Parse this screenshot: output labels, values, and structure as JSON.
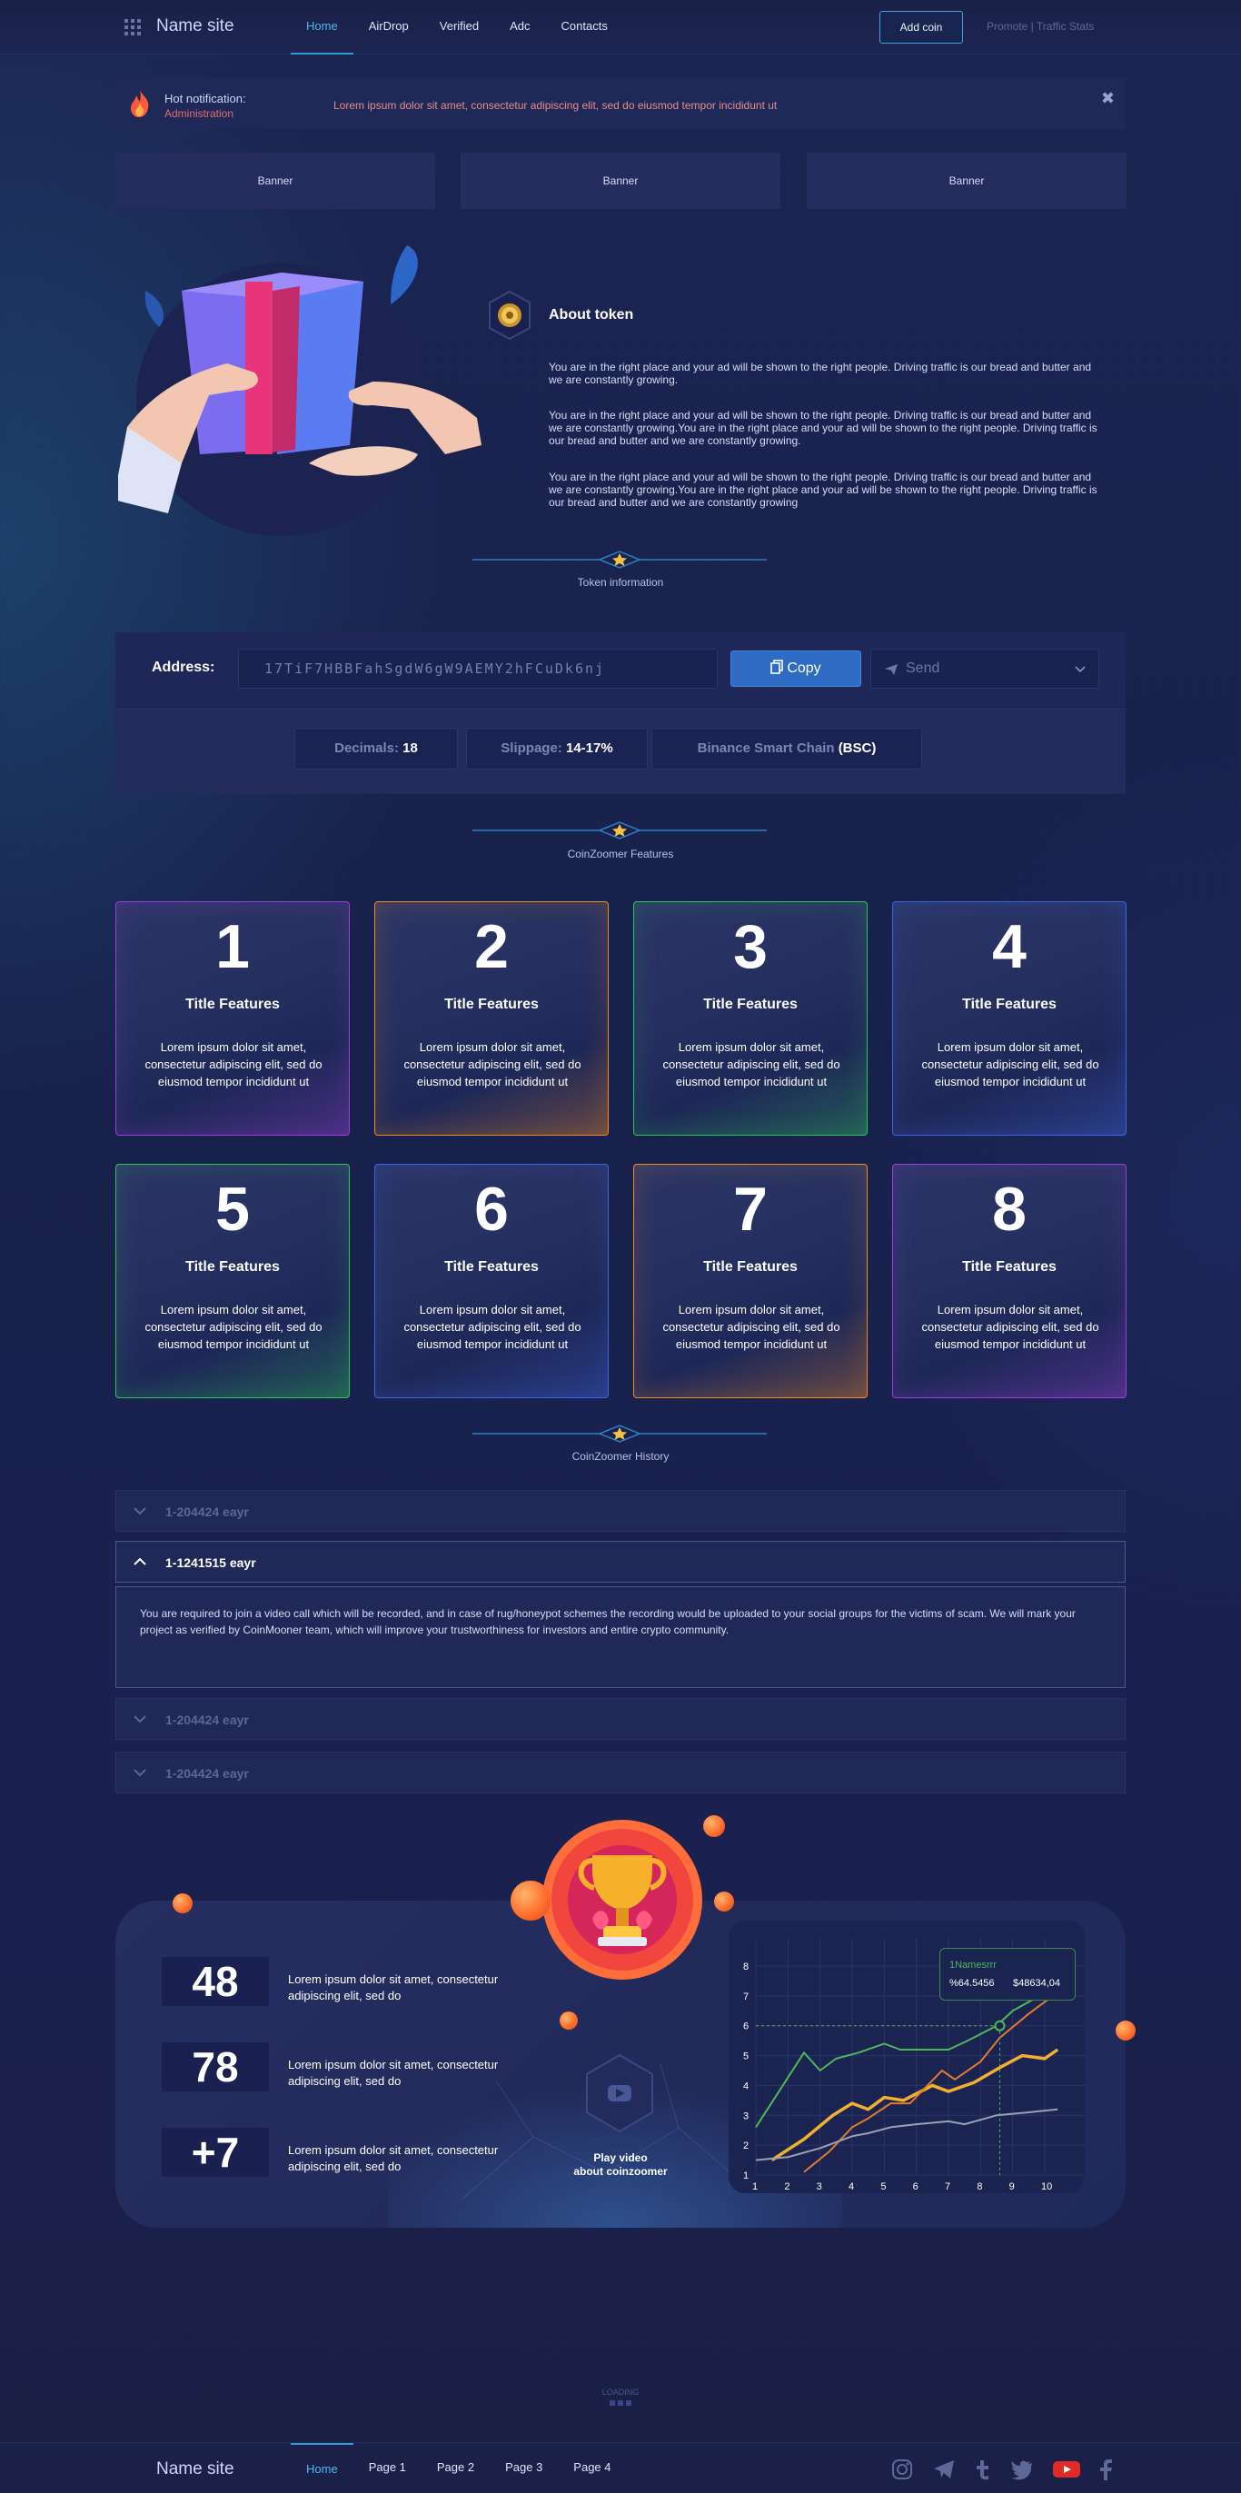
{
  "header": {
    "site_name": "Name site",
    "nav": [
      "Home",
      "AirDrop",
      "Verified",
      "Adc",
      "Contacts"
    ],
    "add_coin": "Add coin",
    "right_links": "Promote | Traffic Stats"
  },
  "notification": {
    "title": "Hot notification:",
    "subtitle": "Administration",
    "text": "Lorem ipsum dolor sit amet, consectetur adipiscing elit, sed do eiusmod tempor incididunt ut"
  },
  "banners": [
    "Banner",
    "Banner",
    "Banner"
  ],
  "about": {
    "title": "About token",
    "paragraphs": [
      "You are in the right place and your ad will be shown to the right people. Driving traffic is our bread and butter and we are constantly growing.",
      "You are in the right place and your ad will be shown to the right people. Driving traffic is our bread and butter and we are constantly growing.You are in the right place and your ad will be shown to the right people. Driving traffic is our bread and butter and we are constantly growing.",
      "You are in the right place and your ad will be shown to the right people. Driving traffic is our bread and butter and we are constantly growing.You are in the right place and your ad will be shown to the right people. Driving traffic is our bread and butter and we are constantly growing"
    ]
  },
  "token_info": {
    "section_label": "Token information",
    "address_label": "Address:",
    "address_value": "17TiF7HBBFahSgdW6gW9AEMY2hFCuDk6nj",
    "copy_label": "Copy",
    "send_label": "Send",
    "decimals_label": "Decimals:",
    "decimals_value": "18",
    "slippage_label": "Slippage:",
    "slippage_value": "14-17%",
    "chain_label": "Binance Smart Chain",
    "chain_value": "(BSC)"
  },
  "features": {
    "section_label": "CoinZoomer Features",
    "items": [
      {
        "num": "1",
        "title": "Title Features",
        "text": "Lorem ipsum dolor sit amet, consectetur adipiscing elit, sed do eiusmod tempor incididunt ut",
        "color": "#9b3fd6"
      },
      {
        "num": "2",
        "title": "Title Features",
        "text": "Lorem ipsum dolor sit amet, consectetur adipiscing elit, sed do eiusmod tempor incididunt ut",
        "color": "#f08a24"
      },
      {
        "num": "3",
        "title": "Title Features",
        "text": "Lorem ipsum dolor sit amet, consectetur adipiscing elit, sed do eiusmod tempor incididunt ut",
        "color": "#2fc45a"
      },
      {
        "num": "4",
        "title": "Title Features",
        "text": "Lorem ipsum dolor sit amet, consectetur adipiscing elit, sed do eiusmod tempor incididunt ut",
        "color": "#3f64e0"
      },
      {
        "num": "5",
        "title": "Title Features",
        "text": "Lorem ipsum dolor sit amet, consectetur adipiscing elit, sed do eiusmod tempor incididunt ut",
        "color": "#2fc45a"
      },
      {
        "num": "6",
        "title": "Title Features",
        "text": "Lorem ipsum dolor sit amet, consectetur adipiscing elit, sed do eiusmod tempor incididunt ut",
        "color": "#3f64e0"
      },
      {
        "num": "7",
        "title": "Title Features",
        "text": "Lorem ipsum dolor sit amet, consectetur adipiscing elit, sed do eiusmod tempor incididunt ut",
        "color": "#f08a24"
      },
      {
        "num": "8",
        "title": "Title Features",
        "text": "Lorem ipsum dolor sit amet, consectetur adipiscing elit, sed do eiusmod tempor incididunt ut",
        "color": "#9b3fd6"
      }
    ]
  },
  "history": {
    "section_label": "CoinZoomer History",
    "items": [
      {
        "label": "1-204424 eayr"
      },
      {
        "label": "1-1241515 eayr",
        "body": "You are required to join a video call which will be recorded, and in case of rug/honeypot schemes the recording would be uploaded to your social groups for the victims of scam. We will mark your project as verified by CoinMooner team, which will improve your trustworthiness for investors and entire crypto community."
      },
      {
        "label": "1-204424 eayr"
      },
      {
        "label": "1-204424 eayr"
      }
    ]
  },
  "stats": {
    "items": [
      {
        "value": "48",
        "text": "Lorem ipsum dolor sit amet, consectetur adipiscing elit, sed do"
      },
      {
        "value": "78",
        "text": "Lorem ipsum dolor sit amet, consectetur adipiscing elit, sed do"
      },
      {
        "value": "+7",
        "text": "Lorem ipsum dolor sit amet, consectetur adipiscing elit, sed do"
      }
    ],
    "play_label_1": "Play video",
    "play_label_2": "about coinzoomer"
  },
  "chart_data": {
    "type": "line",
    "x": [
      1,
      2,
      3,
      4,
      5,
      6,
      7,
      8,
      9,
      10
    ],
    "ylim": [
      1,
      8
    ],
    "xlim": [
      1,
      10
    ],
    "grid": true,
    "series": [
      {
        "color": "#4fb85a",
        "points": [
          [
            1,
            2.6
          ],
          [
            1.6,
            3.6
          ],
          [
            2.5,
            5.1
          ],
          [
            3,
            4.5
          ],
          [
            3.5,
            4.9
          ],
          [
            4.2,
            5.1
          ],
          [
            5,
            5.4
          ],
          [
            5.5,
            5.2
          ],
          [
            7,
            5.2
          ],
          [
            7.6,
            5.5
          ],
          [
            8.5,
            6.0
          ],
          [
            9,
            6.5
          ],
          [
            10,
            7.1
          ],
          [
            10.4,
            7.2
          ]
        ]
      },
      {
        "color": "#f2b030",
        "points": [
          [
            1.5,
            1.5
          ],
          [
            2.5,
            2.2
          ],
          [
            3.4,
            3.0
          ],
          [
            4,
            3.4
          ],
          [
            4.5,
            3.2
          ],
          [
            5,
            3.6
          ],
          [
            5.6,
            3.5
          ],
          [
            6.5,
            4.0
          ],
          [
            7,
            3.8
          ],
          [
            7.8,
            4.1
          ],
          [
            8.6,
            4.6
          ],
          [
            9.3,
            5.0
          ],
          [
            10,
            4.9
          ],
          [
            10.4,
            5.2
          ]
        ]
      },
      {
        "color": "#e07c30",
        "points": [
          [
            2.5,
            1.1
          ],
          [
            3.3,
            1.8
          ],
          [
            4,
            2.6
          ],
          [
            4.5,
            2.9
          ],
          [
            5.2,
            3.4
          ],
          [
            5.8,
            3.4
          ],
          [
            6.8,
            4.5
          ],
          [
            7.2,
            4.2
          ],
          [
            8,
            4.8
          ],
          [
            8.6,
            5.6
          ],
          [
            9.5,
            6.4
          ],
          [
            10,
            6.8
          ],
          [
            10.5,
            7.2
          ]
        ]
      },
      {
        "color": "#9aa0b6",
        "points": [
          [
            1,
            1.5
          ],
          [
            2,
            1.6
          ],
          [
            3,
            1.9
          ],
          [
            4,
            2.3
          ],
          [
            4.5,
            2.4
          ],
          [
            5.2,
            2.6
          ],
          [
            6,
            2.7
          ],
          [
            7,
            2.8
          ],
          [
            7.5,
            2.7
          ],
          [
            8.5,
            3.0
          ],
          [
            9.5,
            3.1
          ],
          [
            10.4,
            3.2
          ]
        ]
      }
    ],
    "marker": {
      "x": 8.6,
      "y": 6.0
    },
    "tooltip": {
      "name": "1Namesrrr",
      "percent": "%64.5456",
      "amount": "$48634,04"
    }
  },
  "loading": "LOADING",
  "footer": {
    "site_name": "Name site",
    "nav": [
      "Home",
      "Page 1",
      "Page 2",
      "Page 3",
      "Page 4"
    ],
    "social": [
      "instagram-icon",
      "telegram-icon",
      "tumblr-icon",
      "twitter-icon",
      "youtube-icon",
      "facebook-icon"
    ]
  },
  "colors": {
    "accent": "#2f9bd6",
    "copy_button": "#2f6bc3",
    "notification_text": "#e86b6b"
  }
}
